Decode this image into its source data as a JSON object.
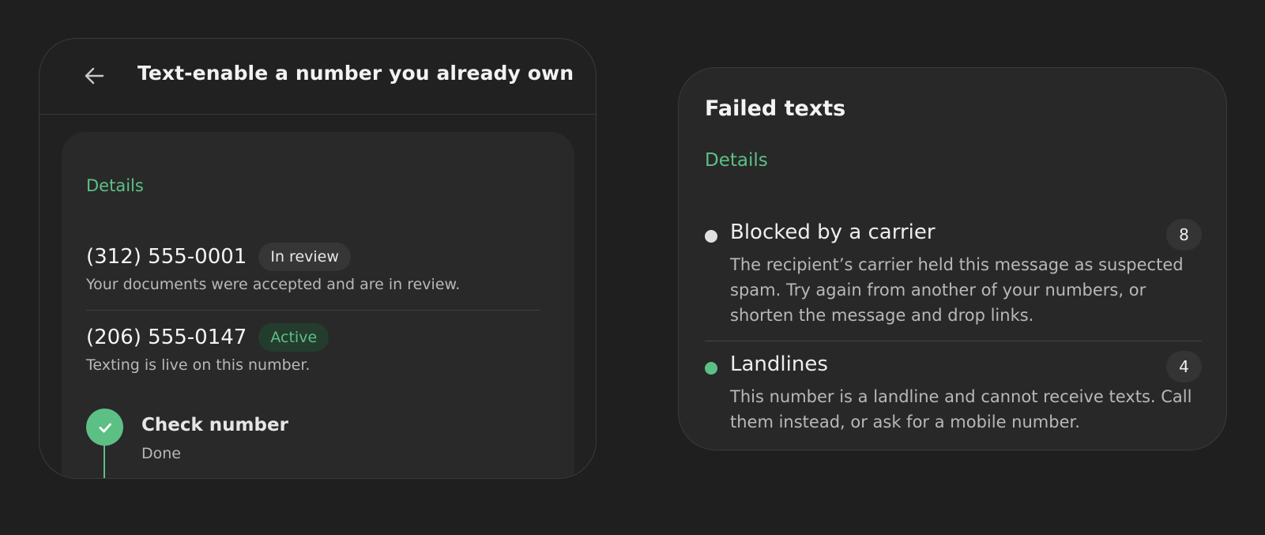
{
  "left_card": {
    "header": {
      "title": "Text-enable a number you already own",
      "back_icon": "arrow-left-icon"
    },
    "details_label": "Details",
    "numbers": [
      {
        "phone": "(312) 555-0001",
        "status": "In review",
        "description": "Your documents were accepted and are in review."
      },
      {
        "phone": "(206) 555-0147",
        "status": "Active",
        "description": "Texting is live on this number."
      }
    ],
    "step": {
      "icon": "check-icon",
      "title": "Check number",
      "status": "Done"
    }
  },
  "right_card": {
    "title": "Failed texts",
    "details_label": "Details",
    "reasons": [
      {
        "title": "Blocked by a carrier",
        "count": "8",
        "description": "The recipient’s carrier held this message as suspected spam. Try again from another of your numbers, or shorten the message and drop links."
      },
      {
        "title": "Landlines",
        "count": "4",
        "description": "This number is a landline and cannot receive texts. Call them instead, or ask for a mobile number."
      }
    ]
  },
  "colors": {
    "background": "#1f1f1f",
    "card": "#212121",
    "panel": "#292929",
    "accent_green": "#5cc085",
    "active_badge_bg": "#243c2d",
    "neutral_dot": "#e0e0e0"
  }
}
